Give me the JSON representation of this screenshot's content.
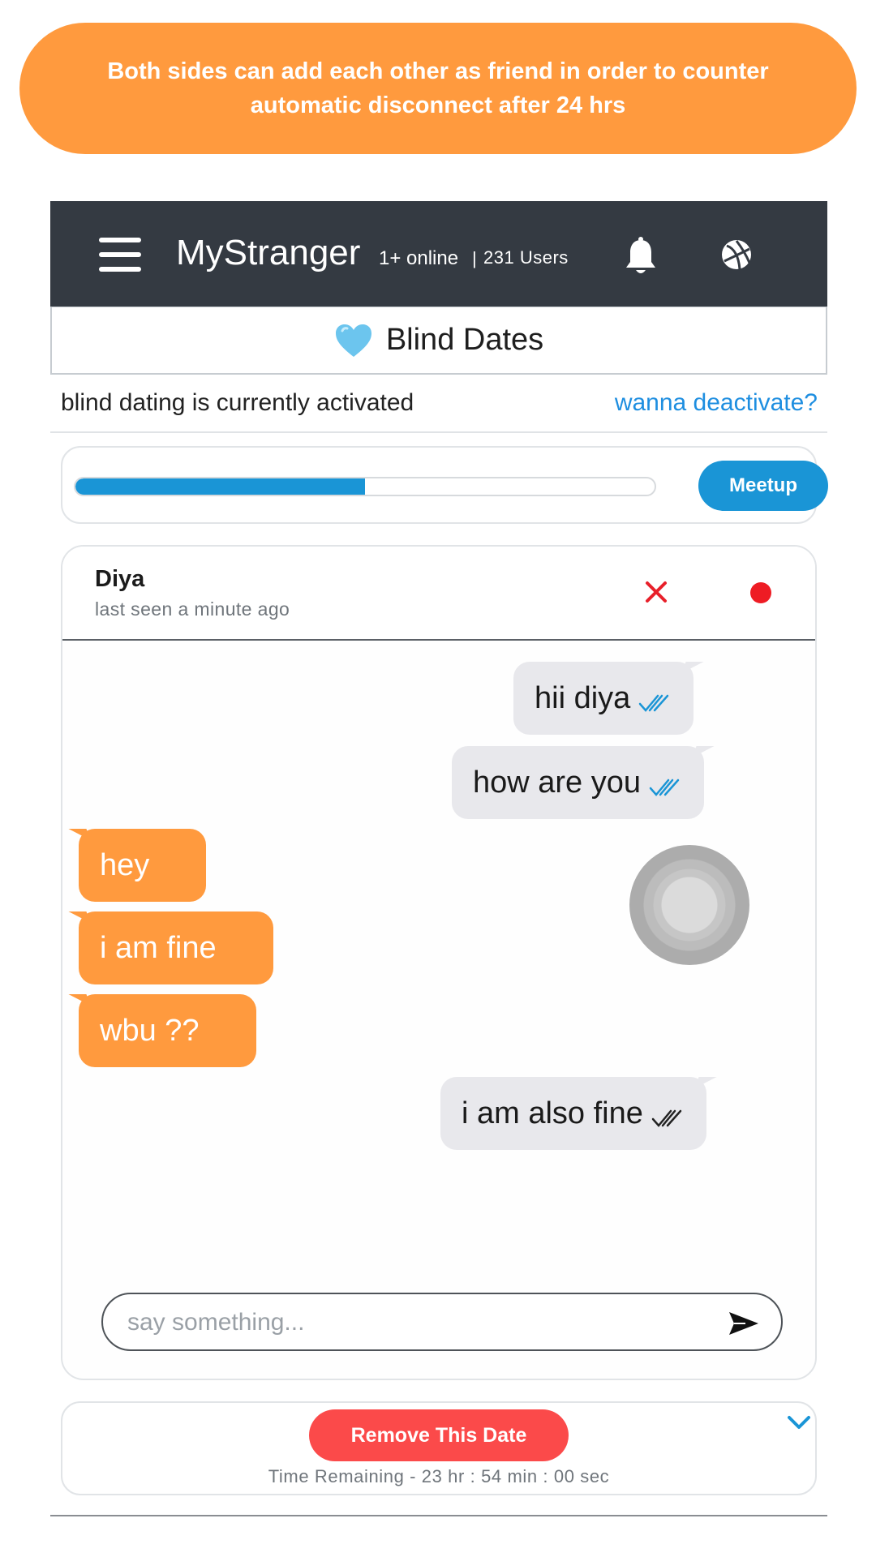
{
  "banner": {
    "text": "Both sides can add each other as friend in order to counter automatic disconnect after 24 hrs"
  },
  "navbar": {
    "brand": "MyStranger",
    "online": "1+ online",
    "separator": "|",
    "users": "231 Users",
    "icons": [
      "menu-icon",
      "bell-icon",
      "ball-icon"
    ]
  },
  "tab": {
    "icon": "heart-icon",
    "title": "Blind Dates"
  },
  "status": {
    "text": "blind dating is currently activated",
    "link": "wanna deactivate?"
  },
  "progress": {
    "value_percent": 50,
    "button": "Meetup",
    "fill_color": "#1a95d6"
  },
  "chat": {
    "name": "Diya",
    "last_seen": "last seen a minute ago",
    "close_icon": "close-icon",
    "status_color": "#ee1c24",
    "messages": [
      {
        "side": "out",
        "text": "hii diya",
        "read": true
      },
      {
        "side": "out",
        "text": "how are you",
        "read": true
      },
      {
        "side": "in",
        "text": "hey"
      },
      {
        "side": "in",
        "text": "i am fine"
      },
      {
        "side": "in",
        "text": "wbu ??"
      },
      {
        "side": "out",
        "text": "i am also fine",
        "read": false
      }
    ],
    "input_placeholder": "say something...",
    "send_icon": "send-icon"
  },
  "footer": {
    "remove_button": "Remove This Date",
    "time_remaining": "Time Remaining - 23 hr : 54 min : 00 sec",
    "chevron_icon": "chevron-down-icon"
  },
  "colors": {
    "accent_orange": "#ff9a3e",
    "navbar": "#343a42",
    "link_blue": "#1e8ee0",
    "danger": "#fb4a4a"
  }
}
